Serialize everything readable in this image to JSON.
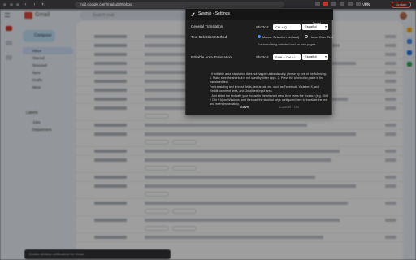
{
  "browser": {
    "url": "mail.google.com/mail/u/0/#inbox",
    "vpn_label": "VPN",
    "update_label": "Update"
  },
  "gmail": {
    "brand": "Gmail",
    "search_placeholder": "Search mail",
    "compose_label": "Compose",
    "nav_items": [
      "Inbox",
      "Starred",
      "Snoozed",
      "Sent",
      "Drafts",
      "More"
    ],
    "labels_heading": "Labels",
    "labels": [
      "Jobs",
      "Department"
    ],
    "snackbar_text": "Enable desktop notifications for Gmail."
  },
  "dialog": {
    "title": "Swanio - Settings",
    "general_translation": {
      "label": "General Translation",
      "shortcut_label": "Shortcut",
      "shortcut_value": "Ctrl + Q",
      "target_label": "Target Language",
      "target_value": "Español"
    },
    "text_selection": {
      "label": "Text Selection Method",
      "options": [
        "Mouse Selection (default)",
        "Hover Over Text"
      ],
      "selected": 0,
      "hint": "For translating selected text on web pages"
    },
    "editable_area": {
      "label": "Editable Area Translation",
      "shortcut_label": "Shortcut",
      "shortcut_value": "Shift + Ctrl + L",
      "target_label": "Target Language",
      "target_value": "Español"
    },
    "notes": [
      "* If editable area translation does not happen automatically, please try one of the following: 1. Make sure the shortcut is not used by other apps. 2. Press the shortcut to paste in the translated text.",
      "For translating text in input fields, text areas, etc. such as Facebook, Youtube, X, and Reddit comment area, and Gmail text input area.",
      "- Just select the text with your mouse in the relevant area, then press the shortcut (e.g. Shift + Ctrl + A) on Windows, and then use the shortcut keys configured here to translate the text and insert immediately."
    ],
    "save_label": "Save",
    "cancel_label": "Cancel / Go"
  },
  "colors": {
    "dialog_bg": "#1e1e1e",
    "radio_selected": "#4d8df7",
    "gmail_bg": "#eef2f8",
    "update_accent": "#d94b3d"
  }
}
